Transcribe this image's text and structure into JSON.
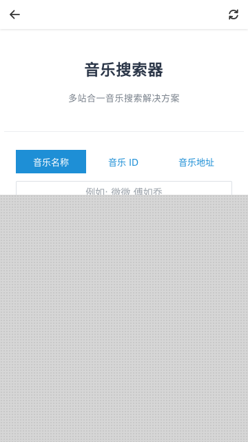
{
  "header": {
    "back_icon": "arrow-left-icon",
    "refresh_icon": "refresh-icon"
  },
  "main": {
    "title": "音乐搜索器",
    "subtitle": "多站合一音乐搜索解决方案"
  },
  "tabs": [
    {
      "label": "音乐名称",
      "active": true
    },
    {
      "label": "音乐 ID",
      "active": false
    },
    {
      "label": "音乐地址",
      "active": false
    }
  ],
  "search": {
    "placeholder": "例如: 微微 傅如乔"
  },
  "colors": {
    "accent": "#1e8fd6",
    "title": "#2b3648",
    "overlay": "#d6d6d6"
  }
}
